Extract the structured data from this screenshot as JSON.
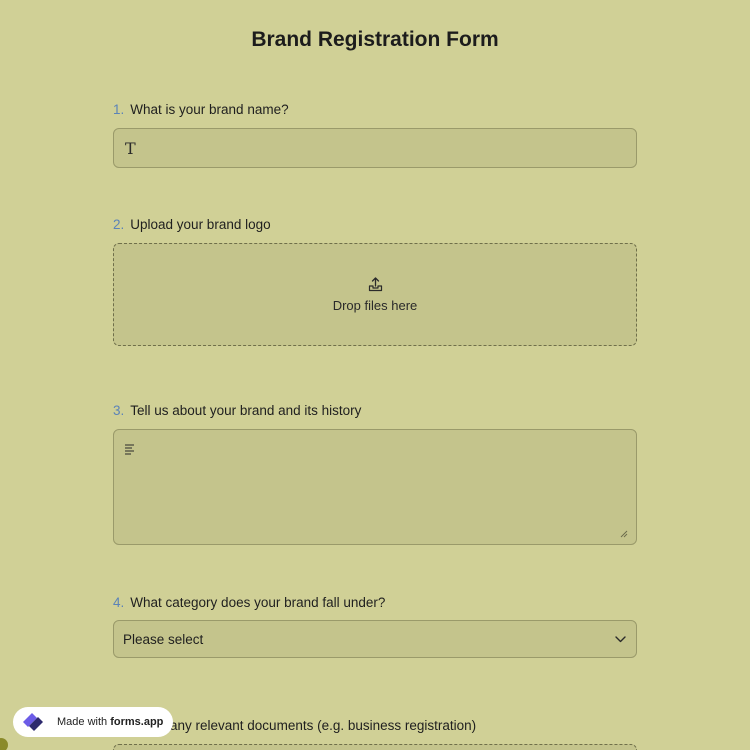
{
  "form": {
    "title": "Brand Registration Form",
    "questions": [
      {
        "number": "1.",
        "label": "What is your brand name?"
      },
      {
        "number": "2.",
        "label": "Upload your brand logo",
        "drop_text": "Drop files here"
      },
      {
        "number": "3.",
        "label": "Tell us about your brand and its history"
      },
      {
        "number": "4.",
        "label": "What category does your brand fall under?",
        "select_value": "Please select"
      },
      {
        "label_partial": "any relevant documents (e.g. business registration)"
      }
    ]
  },
  "badge": {
    "prefix": "Made with ",
    "brand": "forms.app"
  },
  "colors": {
    "background": "#d0d096",
    "field": "#c4c48c",
    "number_accent": "#5b83b8"
  }
}
